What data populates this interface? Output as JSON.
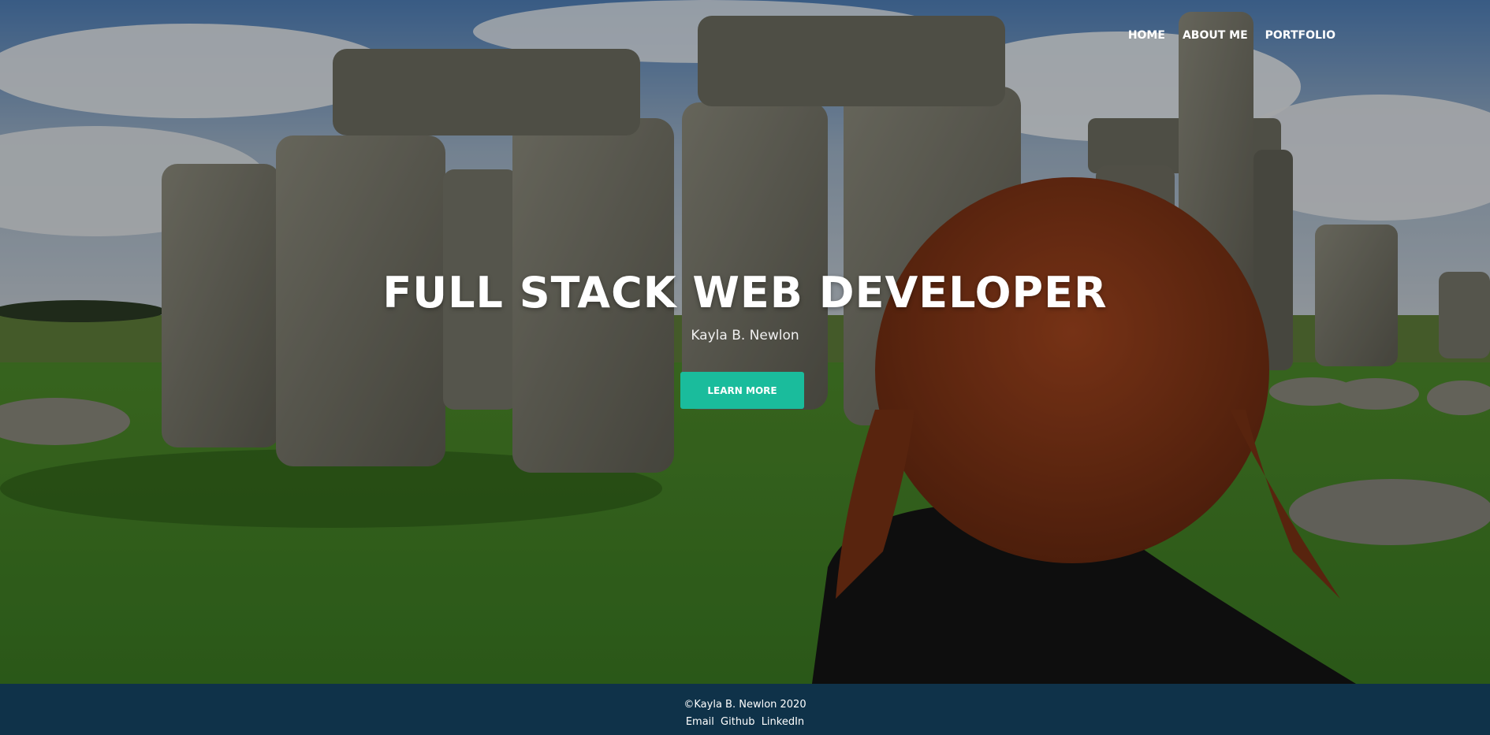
{
  "nav": {
    "items": [
      {
        "label": "HOME"
      },
      {
        "label": "ABOUT ME"
      },
      {
        "label": "PORTFOLIO"
      }
    ]
  },
  "hero": {
    "title": "FULL STACK WEB DEVELOPER",
    "subtitle": "Kayla B. Newlon",
    "cta_label": "LEARN MORE"
  },
  "footer": {
    "copyright": "©Kayla B. Newlon 2020",
    "links": [
      {
        "label": "Email"
      },
      {
        "label": "Github"
      },
      {
        "label": "LinkedIn"
      }
    ]
  },
  "colors": {
    "accent": "#1abc9c",
    "footer_bg": "#0f3249",
    "text": "#ffffff"
  }
}
